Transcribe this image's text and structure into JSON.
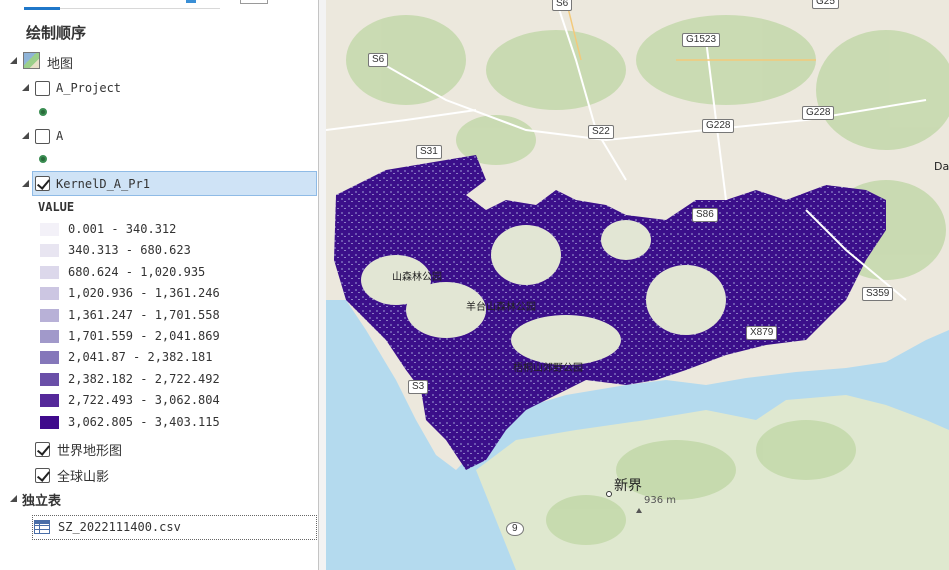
{
  "pane": {
    "section_title": "绘制顺序",
    "map_node": "地图",
    "layers": [
      {
        "name": "A_Project",
        "checked": false
      },
      {
        "name": "A",
        "checked": false
      },
      {
        "name": "KernelD_A_Pr1",
        "checked": true
      }
    ],
    "legend_field": "VALUE",
    "legend": [
      {
        "label": "0.001 - 340.312",
        "color": "#f3f1f8"
      },
      {
        "label": "340.313 - 680.623",
        "color": "#e8e5f1"
      },
      {
        "label": "680.624 - 1,020.935",
        "color": "#dcd8eb"
      },
      {
        "label": "1,020.936 - 1,361.246",
        "color": "#ccc6e2"
      },
      {
        "label": "1,361.247 - 1,701.558",
        "color": "#b8b1d7"
      },
      {
        "label": "1,701.559 - 2,041.869",
        "color": "#a199ca"
      },
      {
        "label": "2,041.87 - 2,382.181",
        "color": "#8577ba"
      },
      {
        "label": "2,382.182 - 2,722.492",
        "color": "#6a4fa8"
      },
      {
        "label": "2,722.493 - 3,062.804",
        "color": "#55299a"
      },
      {
        "label": "3,062.805 - 3,403.115",
        "color": "#3f0a8c"
      }
    ],
    "basemaps": [
      {
        "name": "世界地形图",
        "checked": true
      },
      {
        "name": "全球山影",
        "checked": true
      }
    ],
    "standalone_tables_title": "独立表",
    "table": "SZ_2022111400.csv"
  },
  "map": {
    "road_labels": [
      "S6",
      "G25",
      "G1523",
      "S6",
      "S22",
      "G228",
      "G228",
      "S31",
      "S86",
      "S359",
      "X879",
      "S3",
      "9"
    ],
    "place_labels": [
      "山森林公园",
      "羊台山森林公园",
      "梧桐山郊野公园",
      "新界",
      "936 m",
      "Da"
    ],
    "colors": {
      "water": "#b4daee",
      "land": "#ece8dd",
      "green": "#c4d9ab",
      "density": "#3b0f8a"
    }
  }
}
